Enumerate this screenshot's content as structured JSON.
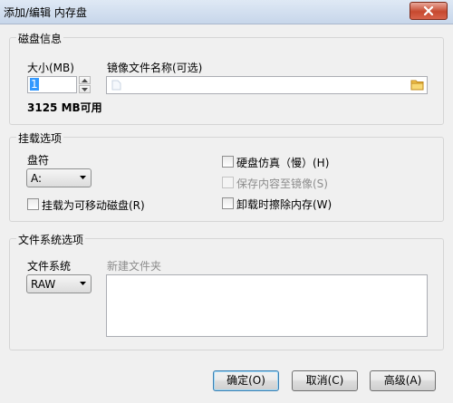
{
  "window": {
    "title": "添加/编辑 内存盘"
  },
  "disk_info": {
    "group_title": "磁盘信息",
    "size_label": "大小(MB)",
    "size_value": "1",
    "available_text": "3125 MB可用",
    "image_label": "镜像文件名称(可选)",
    "image_value": ""
  },
  "mount_options": {
    "group_title": "挂载选项",
    "drive_label": "盘符",
    "drive_value": "A:",
    "removable_label": "挂载为可移动磁盘(R)",
    "removable_checked": false,
    "hdd_emulation_label": "硬盘仿真（慢）(H)",
    "hdd_emulation_checked": false,
    "save_to_image_label": "保存内容至镜像(S)",
    "save_to_image_enabled": false,
    "wipe_on_unmount_label": "卸载时擦除内存(W)",
    "wipe_on_unmount_checked": false
  },
  "filesystem": {
    "group_title": "文件系统选项",
    "fs_label": "文件系统",
    "fs_value": "RAW",
    "new_folder_label": "新建文件夹"
  },
  "buttons": {
    "ok": "确定(O)",
    "cancel": "取消(C)",
    "advanced": "高级(A)"
  },
  "icons": {
    "close": "close-icon",
    "folder": "folder-icon"
  }
}
